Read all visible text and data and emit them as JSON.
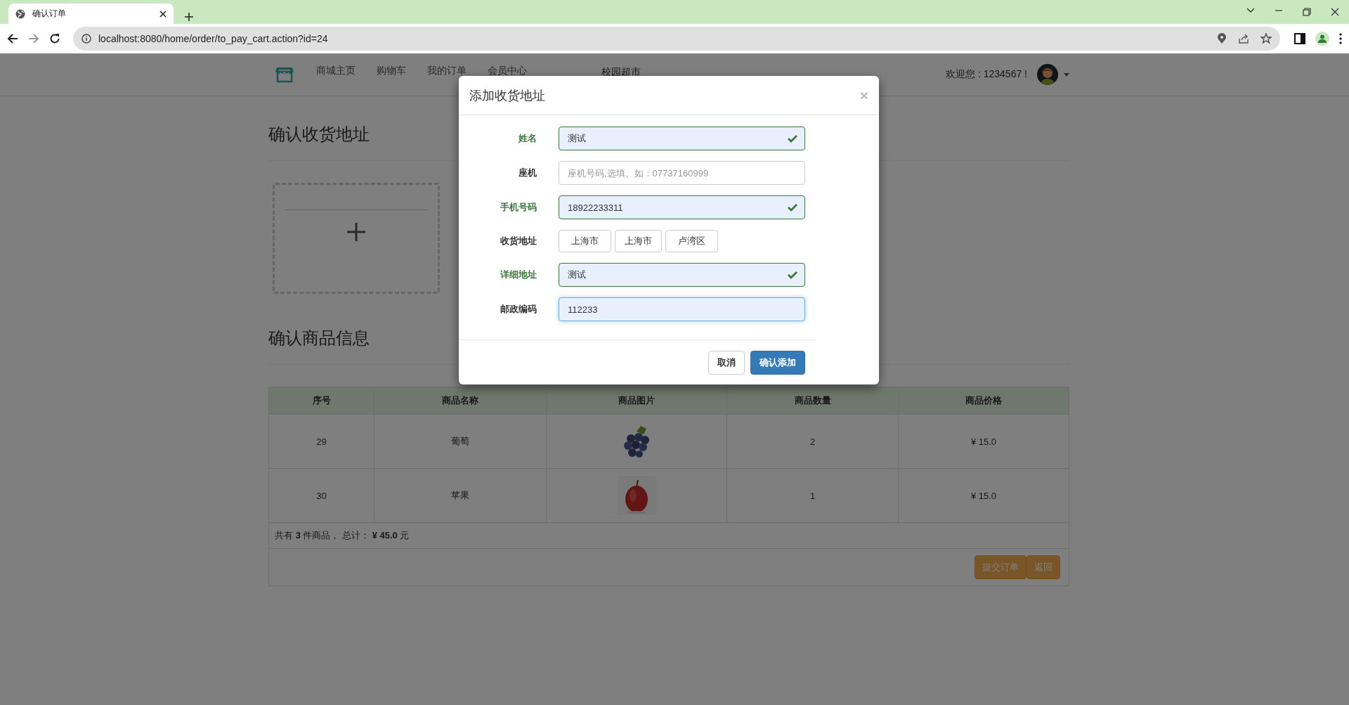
{
  "browser": {
    "tab_title": "确认订单",
    "url": "localhost:8080/home/order/to_pay_cart.action?id=24",
    "forward_disabled": true
  },
  "navbar": {
    "items": [
      {
        "label": "商城主页"
      },
      {
        "label": "购物车"
      },
      {
        "label": "我的订单"
      },
      {
        "label": "会员中心"
      }
    ],
    "brand": "校园超市",
    "welcome": "欢迎您 : 1234567 !"
  },
  "address_section": {
    "title": "确认收货地址"
  },
  "goods_section": {
    "title": "确认商品信息",
    "table": {
      "columns": [
        "序号",
        "商品名称",
        "商品图片",
        "商品数量",
        "商品价格"
      ],
      "rows": [
        {
          "index": "29",
          "name": "葡萄",
          "quantity": "2",
          "price": "¥ 15.0"
        },
        {
          "index": "30",
          "name": "苹果",
          "quantity": "1",
          "price": "¥ 15.0"
        }
      ],
      "summary": "共有 **3** 件商品， 总计： **¥ 45.0** 元",
      "buttons": [
        {
          "label": "提交订单"
        },
        {
          "label": "返回"
        }
      ]
    }
  },
  "modal": {
    "title": "添加收货地址",
    "close": "×",
    "fields": [
      {
        "kind": "input",
        "label": "姓名",
        "value": "测试",
        "valid": true,
        "focused": false
      },
      {
        "kind": "input",
        "label": "座机",
        "placeholder": "座机号码,选填。如：07737160999",
        "valid": false,
        "focused": false
      },
      {
        "kind": "input",
        "label": "手机号码",
        "value": "18922233311",
        "valid": true,
        "focused": false
      },
      {
        "kind": "selects",
        "label": "收货地址",
        "options": [
          "上海市",
          "上海市",
          "卢湾区"
        ],
        "valid": false
      },
      {
        "kind": "input",
        "label": "详细地址",
        "value": "测试",
        "valid": true,
        "focused": false
      },
      {
        "kind": "input",
        "label": "邮政编码",
        "value": "112233",
        "valid": false,
        "focused": true
      }
    ],
    "buttons": [
      {
        "label": "取消",
        "primary": false
      },
      {
        "label": "确认添加",
        "primary": true
      }
    ]
  }
}
